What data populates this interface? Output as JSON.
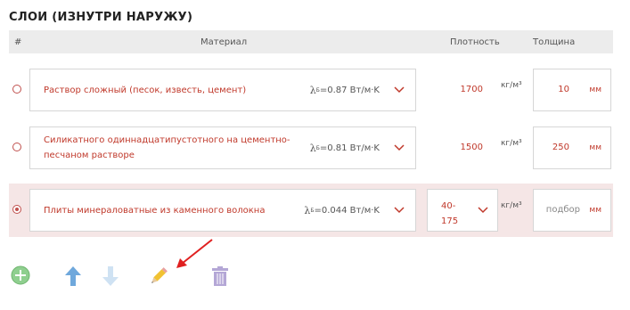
{
  "title": "СЛОИ (ИЗНУТРИ НАРУЖУ)",
  "columns": {
    "num": "#",
    "material": "Материал",
    "density": "Плотность",
    "thickness": "Толщина"
  },
  "layers": [
    {
      "material": "Раствор сложный (песок, известь, цемент)",
      "lambda": "λ",
      "lambda_sub": "Б",
      "lambda_value": "=0.87 Вт/м·K",
      "density": "1700",
      "density_unit": "кг/м³",
      "thickness": "10",
      "thickness_unit": "мм",
      "selected": false
    },
    {
      "material": "Силикатного одиннадцатипустотного на цементно-песчаном растворе",
      "lambda": "λ",
      "lambda_sub": "Б",
      "lambda_value": "=0.81 Вт/м·K",
      "density": "1500",
      "density_unit": "кг/м³",
      "thickness": "250",
      "thickness_unit": "мм",
      "selected": false
    },
    {
      "material": "Плиты минераловатные из каменного волокна",
      "lambda": "λ",
      "lambda_sub": "Б",
      "lambda_value": "=0.044 Вт/м·K",
      "density": "40-175",
      "density_unit": "кг/м³",
      "thickness_placeholder": "подбор",
      "thickness_unit": "мм",
      "selected": true
    }
  ],
  "toolbar": [
    "add-icon",
    "move-up-icon",
    "move-down-icon",
    "edit-pencil-icon",
    "delete-trash-icon"
  ],
  "colors": {
    "accent": "#c0392b",
    "header_bg": "#ececec",
    "selected_row_bg": "#f5e6e6"
  }
}
